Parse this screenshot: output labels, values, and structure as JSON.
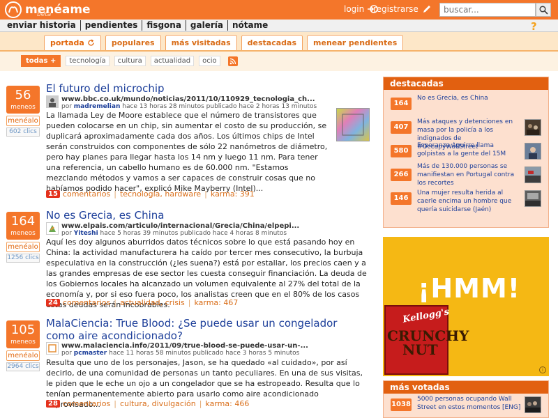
{
  "header": {
    "logo_text": "menéame",
    "logo_sub": "beta",
    "login_label": "login",
    "register_label": "registrarse",
    "search_placeholder": "buscar...",
    "brand_color": "#f4762a"
  },
  "nav": {
    "items": [
      "enviar historia",
      "pendientes",
      "fisgona",
      "galería",
      "nótame"
    ],
    "help_label": "?"
  },
  "tabs": {
    "items": [
      "portada",
      "populares",
      "más visitadas",
      "destacadas",
      "menear pendientes"
    ],
    "active": "portada"
  },
  "filters": {
    "todas_label": "todas",
    "items": [
      "tecnología",
      "cultura",
      "actualidad",
      "ocio"
    ]
  },
  "news": [
    {
      "votes": "56",
      "votes_label": "meneos",
      "menealo_label": "menéalo",
      "clics": "602 clics",
      "title": "El futuro del microchip",
      "url": "www.bbc.co.uk/mundo/noticias/2011/10/110929_tecnologia_ch...",
      "por": "por",
      "user": "madremelian",
      "time": "hace 13 horas 28 minutos publicado hace 2 horas 13 minutos",
      "body": "La llamada Ley de Moore establece que el número de transistores que pueden colocarse en un chip, sin aumentar el costo de su producción, se duplicará aproximadamente cada dos años. Los últimos chips de Intel serán construidos con componentes de sólo 22 nanómetros de diámetro, pero hay planes para llegar hasta los 14 nm y luego 11 nm. Para tener una referencia, un cabello humano es de 60.000 nm. \"Estamos mezclando métodos y vamos a ser capaces de construir cosas que no habíamos podido hacer\", explicó Mike Mayberry (Intel)...",
      "comments": "15",
      "comments_label": "comentarios",
      "tags": "tecnología, hardware",
      "karma": "karma: 391"
    },
    {
      "votes": "164",
      "votes_label": "meneos",
      "menealo_label": "menéalo",
      "clics": "1256 clics",
      "title": "No es Grecia, es China",
      "url": "www.elpais.com/articulo/internacional/Grecia/China/elpepi...",
      "por": "por",
      "user": "Yiteshi",
      "time": "hace 5 horas 39 minutos publicado hace 4 horas 8 minutos",
      "body": "Aquí les doy algunos aburridos datos técnicos sobre lo que está pasando hoy en China: la actividad manufacturera ha caído por tercer mes consecutivo, la burbuja especulativa en la construcción (¿les suena?) está por estallar, los precios caen y a las grandes empresas de ese sector les cuesta conseguir financiación. La deuda de los Gobiernos locales ha alcanzado un volumen equivalente al 27% del total de la economía y, por si eso fuera poco, los analistas creen que en el 80% de los casos estas deudas serán incobrables.",
      "comments": "24",
      "comments_label": "comentarios",
      "tags": "actualidad, crisis",
      "karma": "karma: 467"
    },
    {
      "votes": "105",
      "votes_label": "meneos",
      "menealo_label": "menéalo",
      "clics": "2964 clics",
      "title": "MalaCiencia: True Blood: ¿Se puede usar un congelador como aire acondicionado?",
      "url": "www.malaciencia.info/2011/09/true-blood-se-puede-usar-un-...",
      "por": "por",
      "user": "pcmaster",
      "time": "hace 11 horas 58 minutos publicado hace 3 horas 5 minutos",
      "body": "Resulta que uno de los personajes, Jason, se ha quedado «al cuidado», por así decirlo, de una comunidad de personas un tanto peculiares. En una de sus visitas, le piden que le eche un ojo a un congelador que se ha estropeado. Resulta que lo tenían permanentemente abierto para usarlo como aire acondicionado improvisado...",
      "comments": "28",
      "comments_label": "comentarios",
      "tags": "cultura, divulgación",
      "karma": "karma: 466"
    }
  ],
  "destacadas": {
    "title": "destacadas",
    "items": [
      {
        "count": "164",
        "text": "No es Grecia, es China"
      },
      {
        "count": "407",
        "text": "Más ataques y detenciones en masa por la policía a los indignados de #OccupyWallStreet"
      },
      {
        "count": "580",
        "text": "Esperanza Aguirre llama golpistas a la gente del 15M"
      },
      {
        "count": "266",
        "text": "Más de 130.000 personas se manifiestan en Portugal contra los recortes"
      },
      {
        "count": "146",
        "text": "Una mujer resulta herida al caerle encima un hombre que quería suicidarse (Jaén)"
      }
    ]
  },
  "ad": {
    "hmm": "¡HMM!",
    "brand": "Kellogg's",
    "product_1": "CRUNCHY",
    "product_2": "NUT",
    "info": "i"
  },
  "mas_votadas": {
    "title": "más votadas",
    "items": [
      {
        "count": "1038",
        "text": "5000 personas ocupando Wall Street en estos momentos [ENG]"
      }
    ]
  }
}
